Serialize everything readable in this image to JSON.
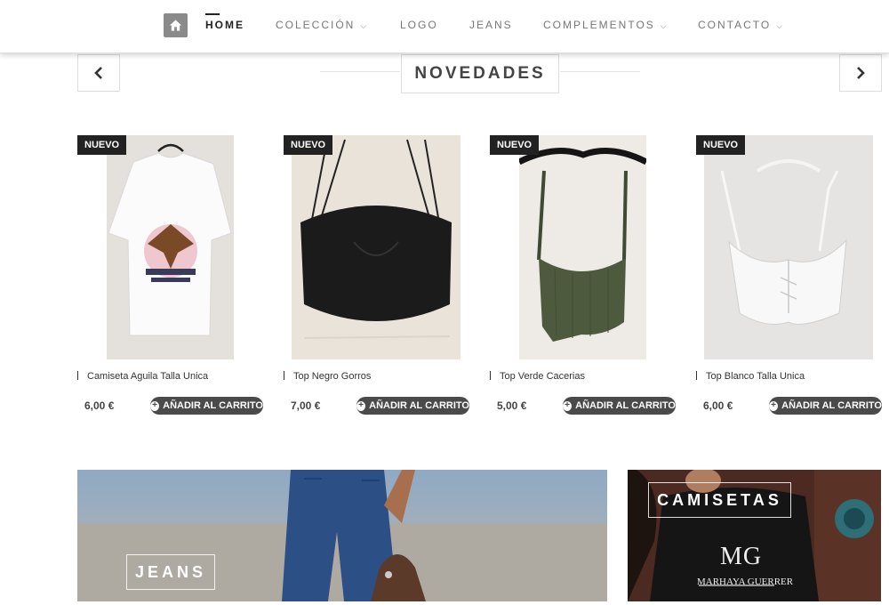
{
  "nav": {
    "items": [
      {
        "label": "HOME",
        "has_dropdown": false,
        "active": true
      },
      {
        "label": "COLECCIÓN",
        "has_dropdown": true
      },
      {
        "label": "LOGO",
        "has_dropdown": false
      },
      {
        "label": "JEANS",
        "has_dropdown": false
      },
      {
        "label": "COMPLEMENTOS",
        "has_dropdown": true
      },
      {
        "label": "CONTACTO",
        "has_dropdown": true
      }
    ],
    "home_icon": "home-icon",
    "dropdown_icon": "chevron-down-icon"
  },
  "section": {
    "title": "NOVEDADES",
    "prev_icon": "chevron-left-icon",
    "next_icon": "chevron-right-icon"
  },
  "products": [
    {
      "badge": "NUEVO",
      "name": "Camiseta Aguila Talla Unica",
      "price": "6,00 €",
      "cart_label": "AÑADIR AL CARRITO"
    },
    {
      "badge": "NUEVO",
      "name": "Top Negro Gorros",
      "price": "7,00 €",
      "cart_label": "AÑADIR AL CARRITO"
    },
    {
      "badge": "NUEVO",
      "name": "Top Verde Cacerias",
      "price": "5,00 €",
      "cart_label": "AÑADIR AL CARRITO"
    },
    {
      "badge": "NUEVO",
      "name": "Top Blanco Talla Unica",
      "price": "6,00 €",
      "cart_label": "AÑADIR AL CARRITO"
    }
  ],
  "banners": {
    "jeans_label": "JEANS",
    "camisetas_label": "CAMISETAS",
    "camisetas_logo_initials": "MG",
    "camisetas_logo_text": "MARHAYA GUERRER"
  },
  "colors": {
    "badge_bg": "#222222",
    "button_bg": "#4a4a4a",
    "nav_text": "#777777"
  }
}
